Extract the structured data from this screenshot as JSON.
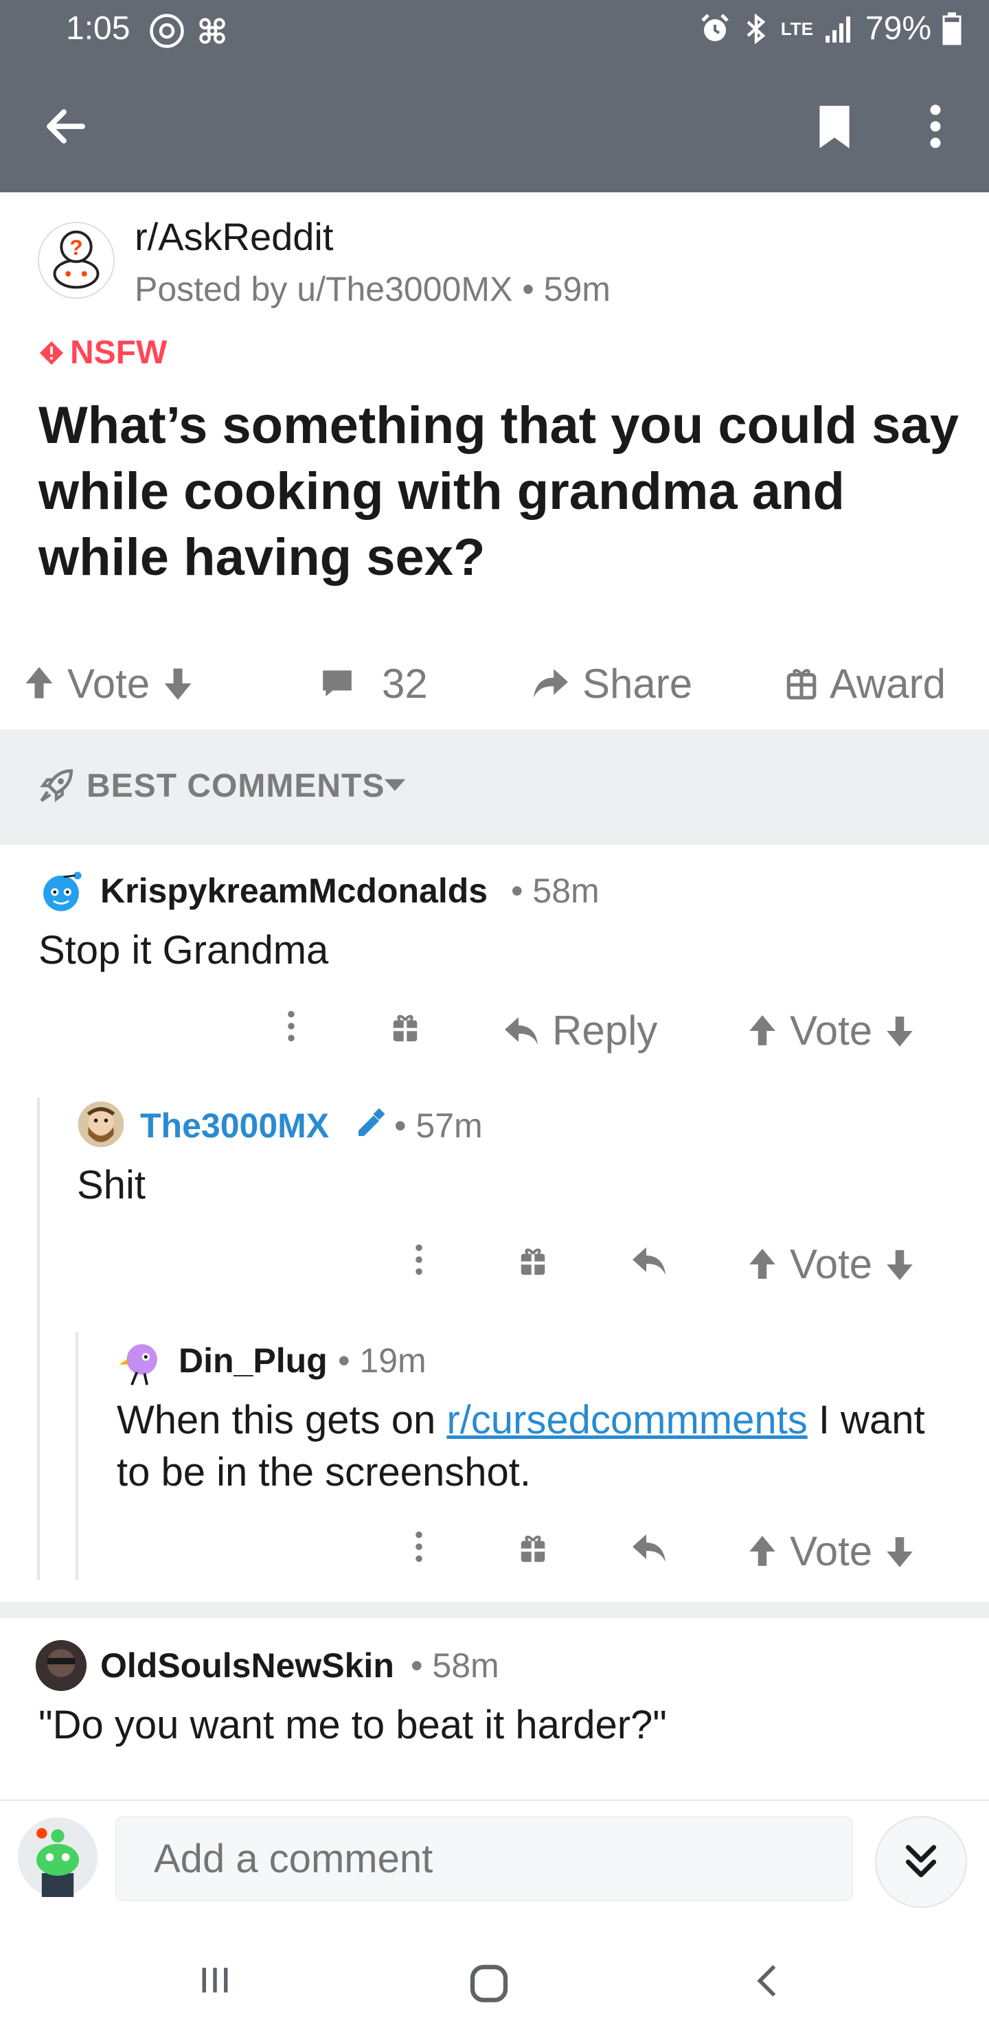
{
  "status_bar": {
    "time": "1:05",
    "battery_percent": "79%",
    "network": "LTE",
    "battery_level": 0.79,
    "icons": [
      "at-icon",
      "fan-icon",
      "alarm-icon",
      "bluetooth-icon",
      "lte-icon",
      "signal-icon",
      "battery-icon"
    ]
  },
  "toolbar": {
    "icons": [
      "back-arrow-icon",
      "bookmark-icon",
      "more-vertical-icon"
    ]
  },
  "post": {
    "subreddit": "r/AskReddit",
    "posted_by": "Posted by u/The3000MX • 59m",
    "nsfw_label": "NSFW",
    "title": "What’s something that you could say while cooking with grandma and while having sex?",
    "vote_label": "Vote",
    "comment_count": "32",
    "share_label": "Share",
    "award_label": "Award"
  },
  "sort": {
    "label": "BEST COMMENTS"
  },
  "comments": [
    {
      "username": "KrispykreamMcdonalds",
      "meta": "• 58m",
      "body": "Stop it Grandma",
      "reply_label": "Reply",
      "vote_label": "Vote"
    },
    {
      "username": "The3000MX",
      "meta": "• 57m",
      "body": "Shit",
      "vote_label": "Vote"
    },
    {
      "username": "Din_Plug",
      "meta": "• 19m",
      "body_before": "When this gets on ",
      "body_link": "r/cursedcommments",
      "body_after": " I want to be in the screenshot.",
      "vote_label": "Vote"
    },
    {
      "username": "OldSoulsNewSkin",
      "meta": "• 58m",
      "body": "\"Do you want me to beat it harder?\""
    }
  ],
  "composer": {
    "placeholder": "Add a comment"
  },
  "colors": {
    "toolbar": "#636a73",
    "nsfw": "#ff4757",
    "link": "#2a8bd0",
    "op": "#2a8bd0",
    "muted": "#7c7c7c",
    "sort_bg": "#edeff1"
  }
}
